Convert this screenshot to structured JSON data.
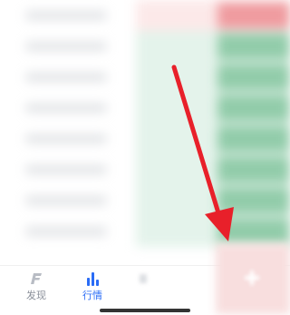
{
  "colors": {
    "accent_blue": "#2a6cf6",
    "arrow_red": "#e8202a",
    "down_green": "#6dbb8e",
    "up_red": "#ea7a7f"
  },
  "tabs": [
    {
      "label": "发现",
      "icon": "discover-icon",
      "active": false
    },
    {
      "label": "行情",
      "icon": "market-chart-icon",
      "active": true
    },
    {
      "label": "",
      "icon": "partial-icon",
      "active": false
    }
  ]
}
